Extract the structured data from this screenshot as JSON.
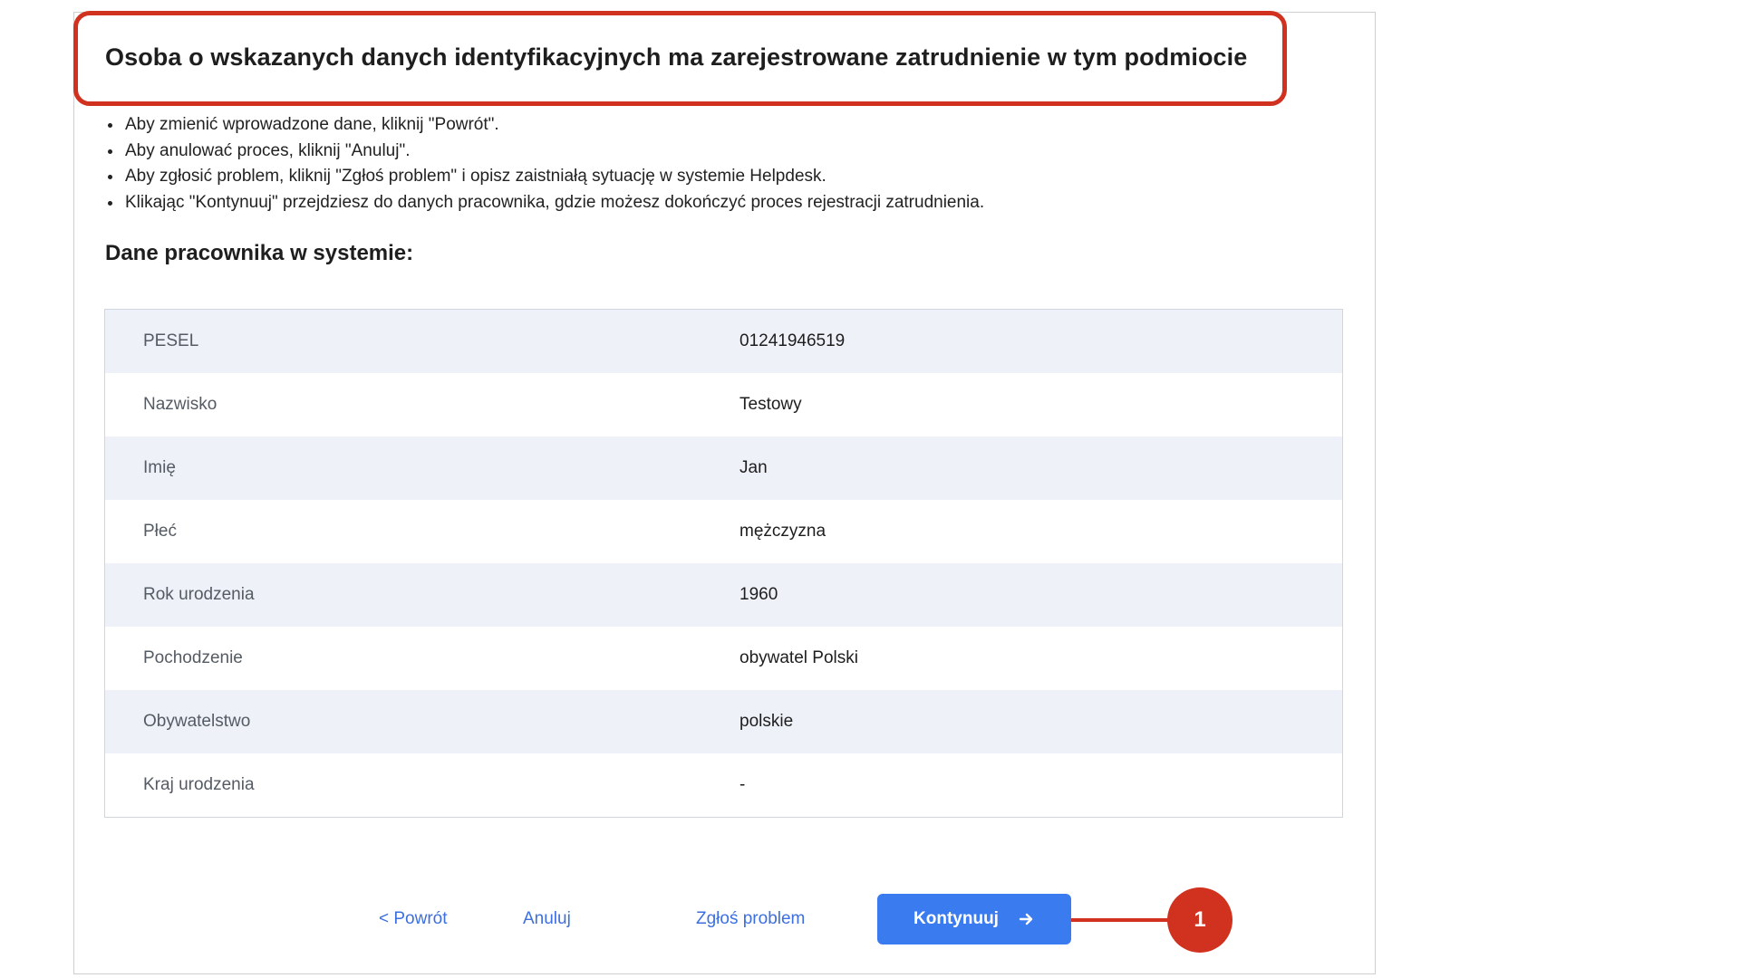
{
  "header": {
    "title": "Osoba o wskazanych danych identyfikacyjnych ma zarejestrowane zatrudnienie w tym podmiocie"
  },
  "instructions": [
    "Aby zmienić wprowadzone dane, kliknij \"Powrót\".",
    "Aby anulować proces, kliknij \"Anuluj\".",
    "Aby zgłosić problem, kliknij \"Zgłoś problem\" i opisz zaistniałą sytuację w systemie Helpdesk.",
    "Klikając \"Kontynuuj\" przejdziesz do danych pracownika, gdzie możesz dokończyć proces rejestracji zatrudnienia."
  ],
  "section": {
    "title": "Dane pracownika w systemie:"
  },
  "employee_rows": [
    {
      "label": "PESEL",
      "value": "01241946519"
    },
    {
      "label": "Nazwisko",
      "value": "Testowy"
    },
    {
      "label": "Imię",
      "value": "Jan"
    },
    {
      "label": "Płeć",
      "value": "mężczyzna"
    },
    {
      "label": "Rok urodzenia",
      "value": "1960"
    },
    {
      "label": "Pochodzenie",
      "value": "obywatel Polski"
    },
    {
      "label": "Obywatelstwo",
      "value": "polskie"
    },
    {
      "label": "Kraj urodzenia",
      "value": "-"
    }
  ],
  "actions": {
    "back_label": "< Powrót",
    "cancel_label": "Anuluj",
    "report_label": "Zgłoś problem",
    "continue_label": "Kontynuuj",
    "continue_icon": "arrow-right-icon"
  },
  "callout": {
    "number": "1"
  },
  "colors": {
    "accent_red": "#d1311f",
    "primary_blue": "#3b7bf0",
    "link_blue": "#3d6fe0",
    "row_stripe": "#eef2f8"
  }
}
